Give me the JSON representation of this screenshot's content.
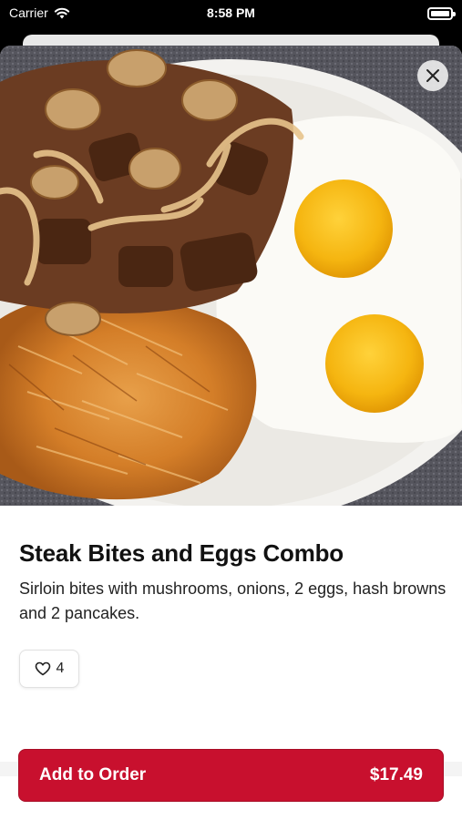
{
  "status_bar": {
    "carrier": "Carrier",
    "time": "8:58 PM"
  },
  "item": {
    "title": "Steak Bites and Eggs Combo",
    "description": "Sirloin bites with mushrooms, onions, 2 eggs, hash browns and 2 pancakes.",
    "likes": "4"
  },
  "order": {
    "label": "Add to Order",
    "price": "$17.49"
  },
  "icons": {
    "close": "close-icon",
    "heart": "heart-icon",
    "wifi": "wifi-icon",
    "battery": "battery-icon"
  },
  "colors": {
    "accent": "#c8102e"
  }
}
